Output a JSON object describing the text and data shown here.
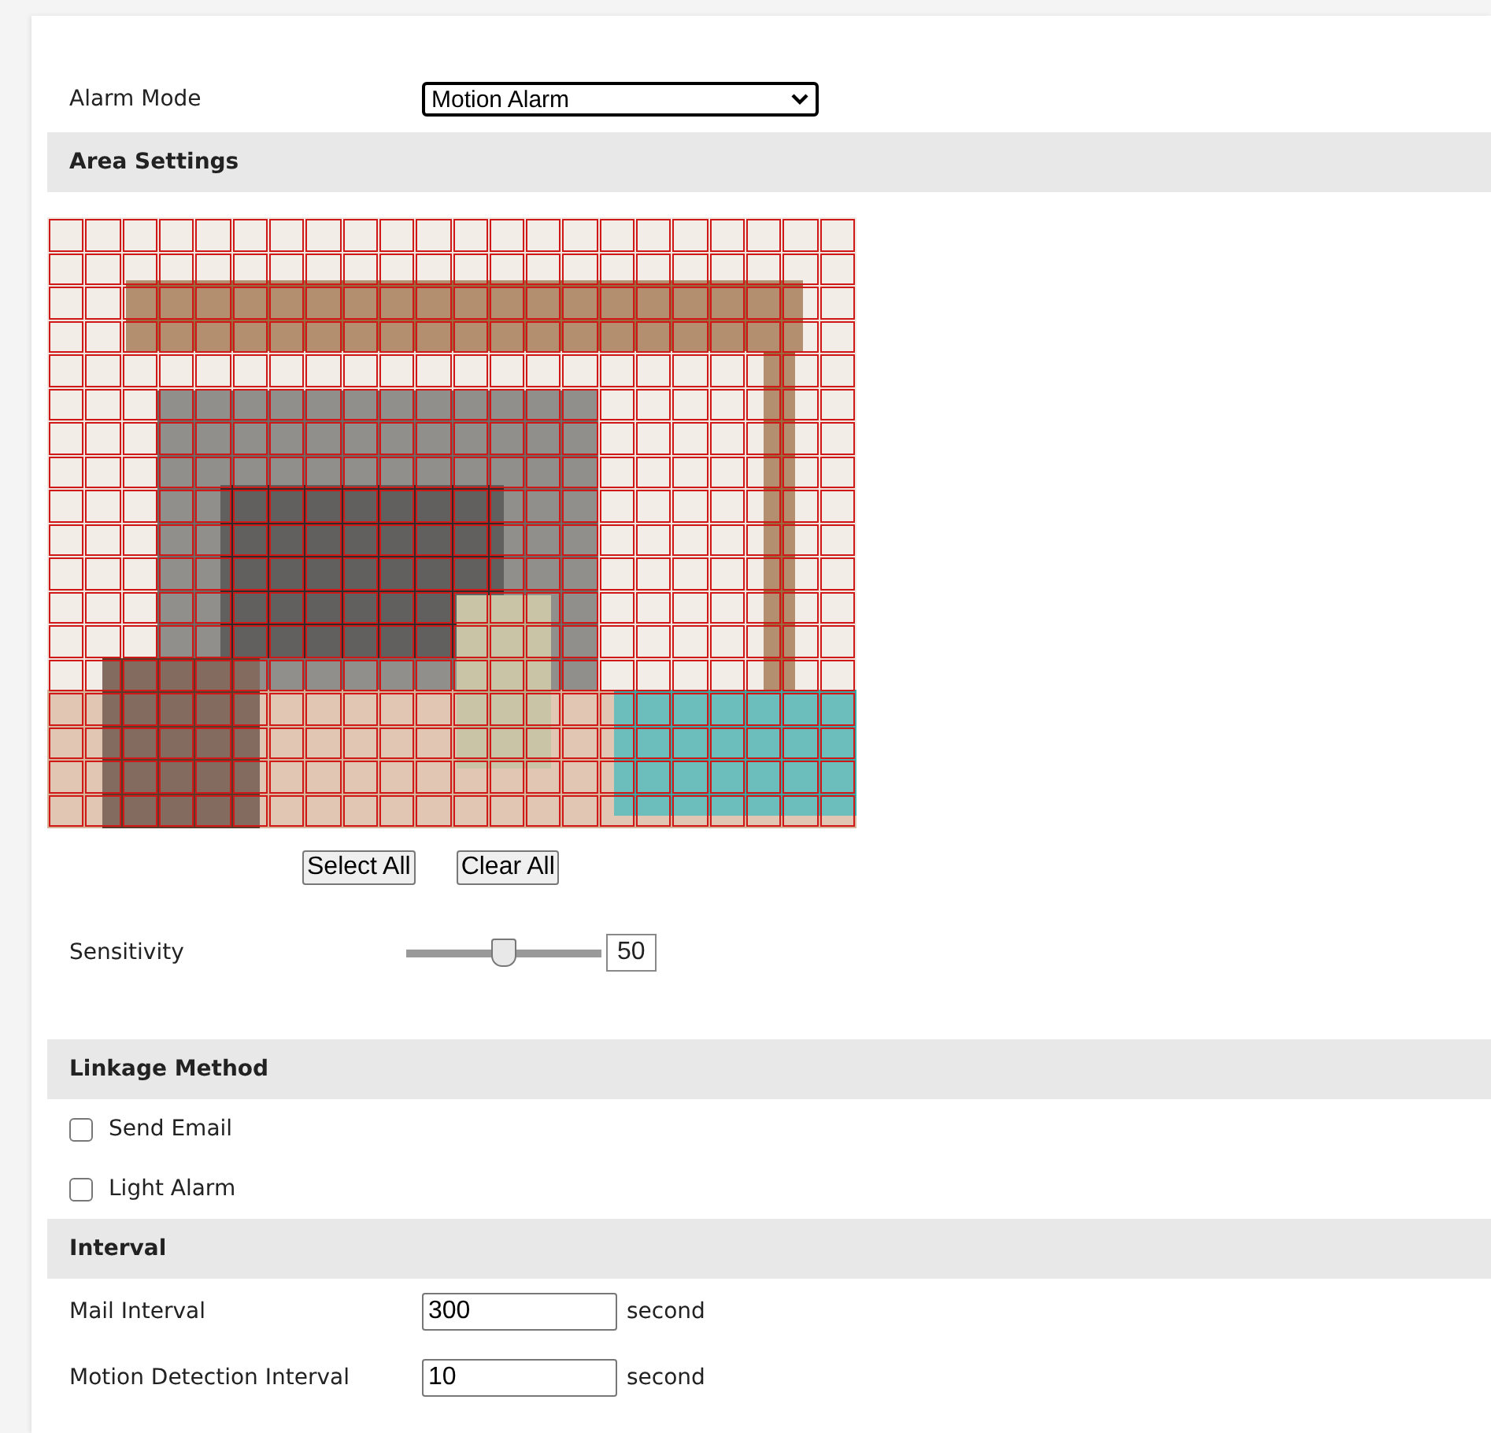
{
  "alarm_mode": {
    "label": "Alarm Mode",
    "value": "Motion Alarm"
  },
  "area_settings": {
    "title": "Area Settings",
    "grid_rows": [
      {
        "selected": [
          true,
          true,
          true,
          true,
          true,
          true,
          true,
          true,
          true,
          true,
          true,
          true,
          true,
          true,
          true,
          true,
          true,
          true,
          true,
          true,
          true,
          true
        ]
      },
      {
        "selected": [
          true,
          true,
          true,
          true,
          true,
          true,
          true,
          true,
          true,
          true,
          true,
          true,
          true,
          true,
          true,
          true,
          true,
          true,
          true,
          true,
          true,
          true
        ]
      },
      {
        "selected": [
          true,
          true,
          true,
          true,
          true,
          true,
          true,
          true,
          true,
          true,
          true,
          true,
          true,
          true,
          true,
          true,
          true,
          true,
          true,
          true,
          true,
          true
        ]
      },
      {
        "selected": [
          true,
          true,
          true,
          true,
          true,
          true,
          true,
          true,
          true,
          true,
          true,
          true,
          true,
          true,
          true,
          true,
          true,
          true,
          true,
          true,
          true,
          true
        ]
      },
      {
        "selected": [
          true,
          true,
          true,
          true,
          true,
          true,
          true,
          true,
          true,
          true,
          true,
          true,
          true,
          true,
          true,
          true,
          true,
          true,
          true,
          true,
          true,
          true
        ]
      },
      {
        "selected": [
          true,
          true,
          true,
          true,
          true,
          true,
          true,
          true,
          true,
          true,
          true,
          true,
          true,
          true,
          true,
          true,
          true,
          true,
          true,
          true,
          true,
          true
        ]
      },
      {
        "selected": [
          true,
          true,
          true,
          true,
          true,
          true,
          true,
          true,
          true,
          true,
          true,
          true,
          true,
          true,
          true,
          true,
          true,
          true,
          true,
          true,
          true,
          true
        ]
      },
      {
        "selected": [
          true,
          true,
          true,
          true,
          true,
          true,
          true,
          true,
          true,
          true,
          true,
          true,
          true,
          true,
          true,
          true,
          true,
          true,
          true,
          true,
          true,
          true
        ]
      },
      {
        "selected": [
          true,
          true,
          true,
          true,
          true,
          true,
          true,
          true,
          true,
          true,
          true,
          true,
          true,
          true,
          true,
          true,
          true,
          true,
          true,
          true,
          true,
          true
        ]
      },
      {
        "selected": [
          true,
          true,
          true,
          true,
          true,
          true,
          true,
          true,
          true,
          true,
          true,
          true,
          true,
          true,
          true,
          true,
          true,
          true,
          true,
          true,
          true,
          true
        ]
      },
      {
        "selected": [
          true,
          true,
          true,
          true,
          true,
          true,
          true,
          true,
          true,
          true,
          true,
          true,
          true,
          true,
          true,
          true,
          true,
          true,
          true,
          true,
          true,
          true
        ]
      },
      {
        "selected": [
          true,
          true,
          true,
          true,
          true,
          true,
          true,
          true,
          true,
          true,
          true,
          true,
          true,
          true,
          true,
          true,
          true,
          true,
          true,
          true,
          true,
          true
        ]
      },
      {
        "selected": [
          true,
          true,
          true,
          true,
          true,
          true,
          true,
          true,
          true,
          true,
          true,
          true,
          true,
          true,
          true,
          true,
          true,
          true,
          true,
          true,
          true,
          true
        ]
      },
      {
        "selected": [
          true,
          true,
          true,
          true,
          true,
          true,
          true,
          true,
          true,
          true,
          true,
          true,
          true,
          true,
          true,
          true,
          true,
          true,
          true,
          true,
          true,
          true
        ]
      },
      {
        "selected": [
          true,
          true,
          true,
          true,
          true,
          true,
          true,
          true,
          true,
          true,
          true,
          true,
          true,
          true,
          true,
          true,
          true,
          true,
          true,
          true,
          true,
          true
        ]
      },
      {
        "selected": [
          true,
          true,
          true,
          true,
          true,
          true,
          true,
          true,
          true,
          true,
          true,
          true,
          true,
          true,
          true,
          true,
          true,
          true,
          true,
          true,
          true,
          true
        ]
      },
      {
        "selected": [
          true,
          true,
          true,
          true,
          true,
          true,
          true,
          true,
          true,
          true,
          true,
          true,
          true,
          true,
          true,
          true,
          true,
          true,
          true,
          true,
          true,
          true
        ]
      },
      {
        "selected": [
          true,
          true,
          true,
          true,
          true,
          true,
          true,
          true,
          true,
          true,
          true,
          true,
          true,
          true,
          true,
          true,
          true,
          true,
          true,
          true,
          true,
          true
        ]
      }
    ],
    "buttons": [
      "Select All",
      "Clear All"
    ],
    "sensitivity": {
      "label": "Sensitivity",
      "level": 0.5,
      "value": "50"
    }
  },
  "linkage_method": {
    "title": "Linkage Method",
    "options": [
      {
        "label": "Send Email",
        "checked": false
      },
      {
        "label": "Light Alarm",
        "checked": false
      }
    ]
  },
  "interval": {
    "title": "Interval",
    "fields": [
      {
        "label": "Mail Interval",
        "value": "300",
        "unit": "second"
      },
      {
        "label": "Motion Detection Interval",
        "value": "10",
        "unit": "second"
      }
    ]
  }
}
